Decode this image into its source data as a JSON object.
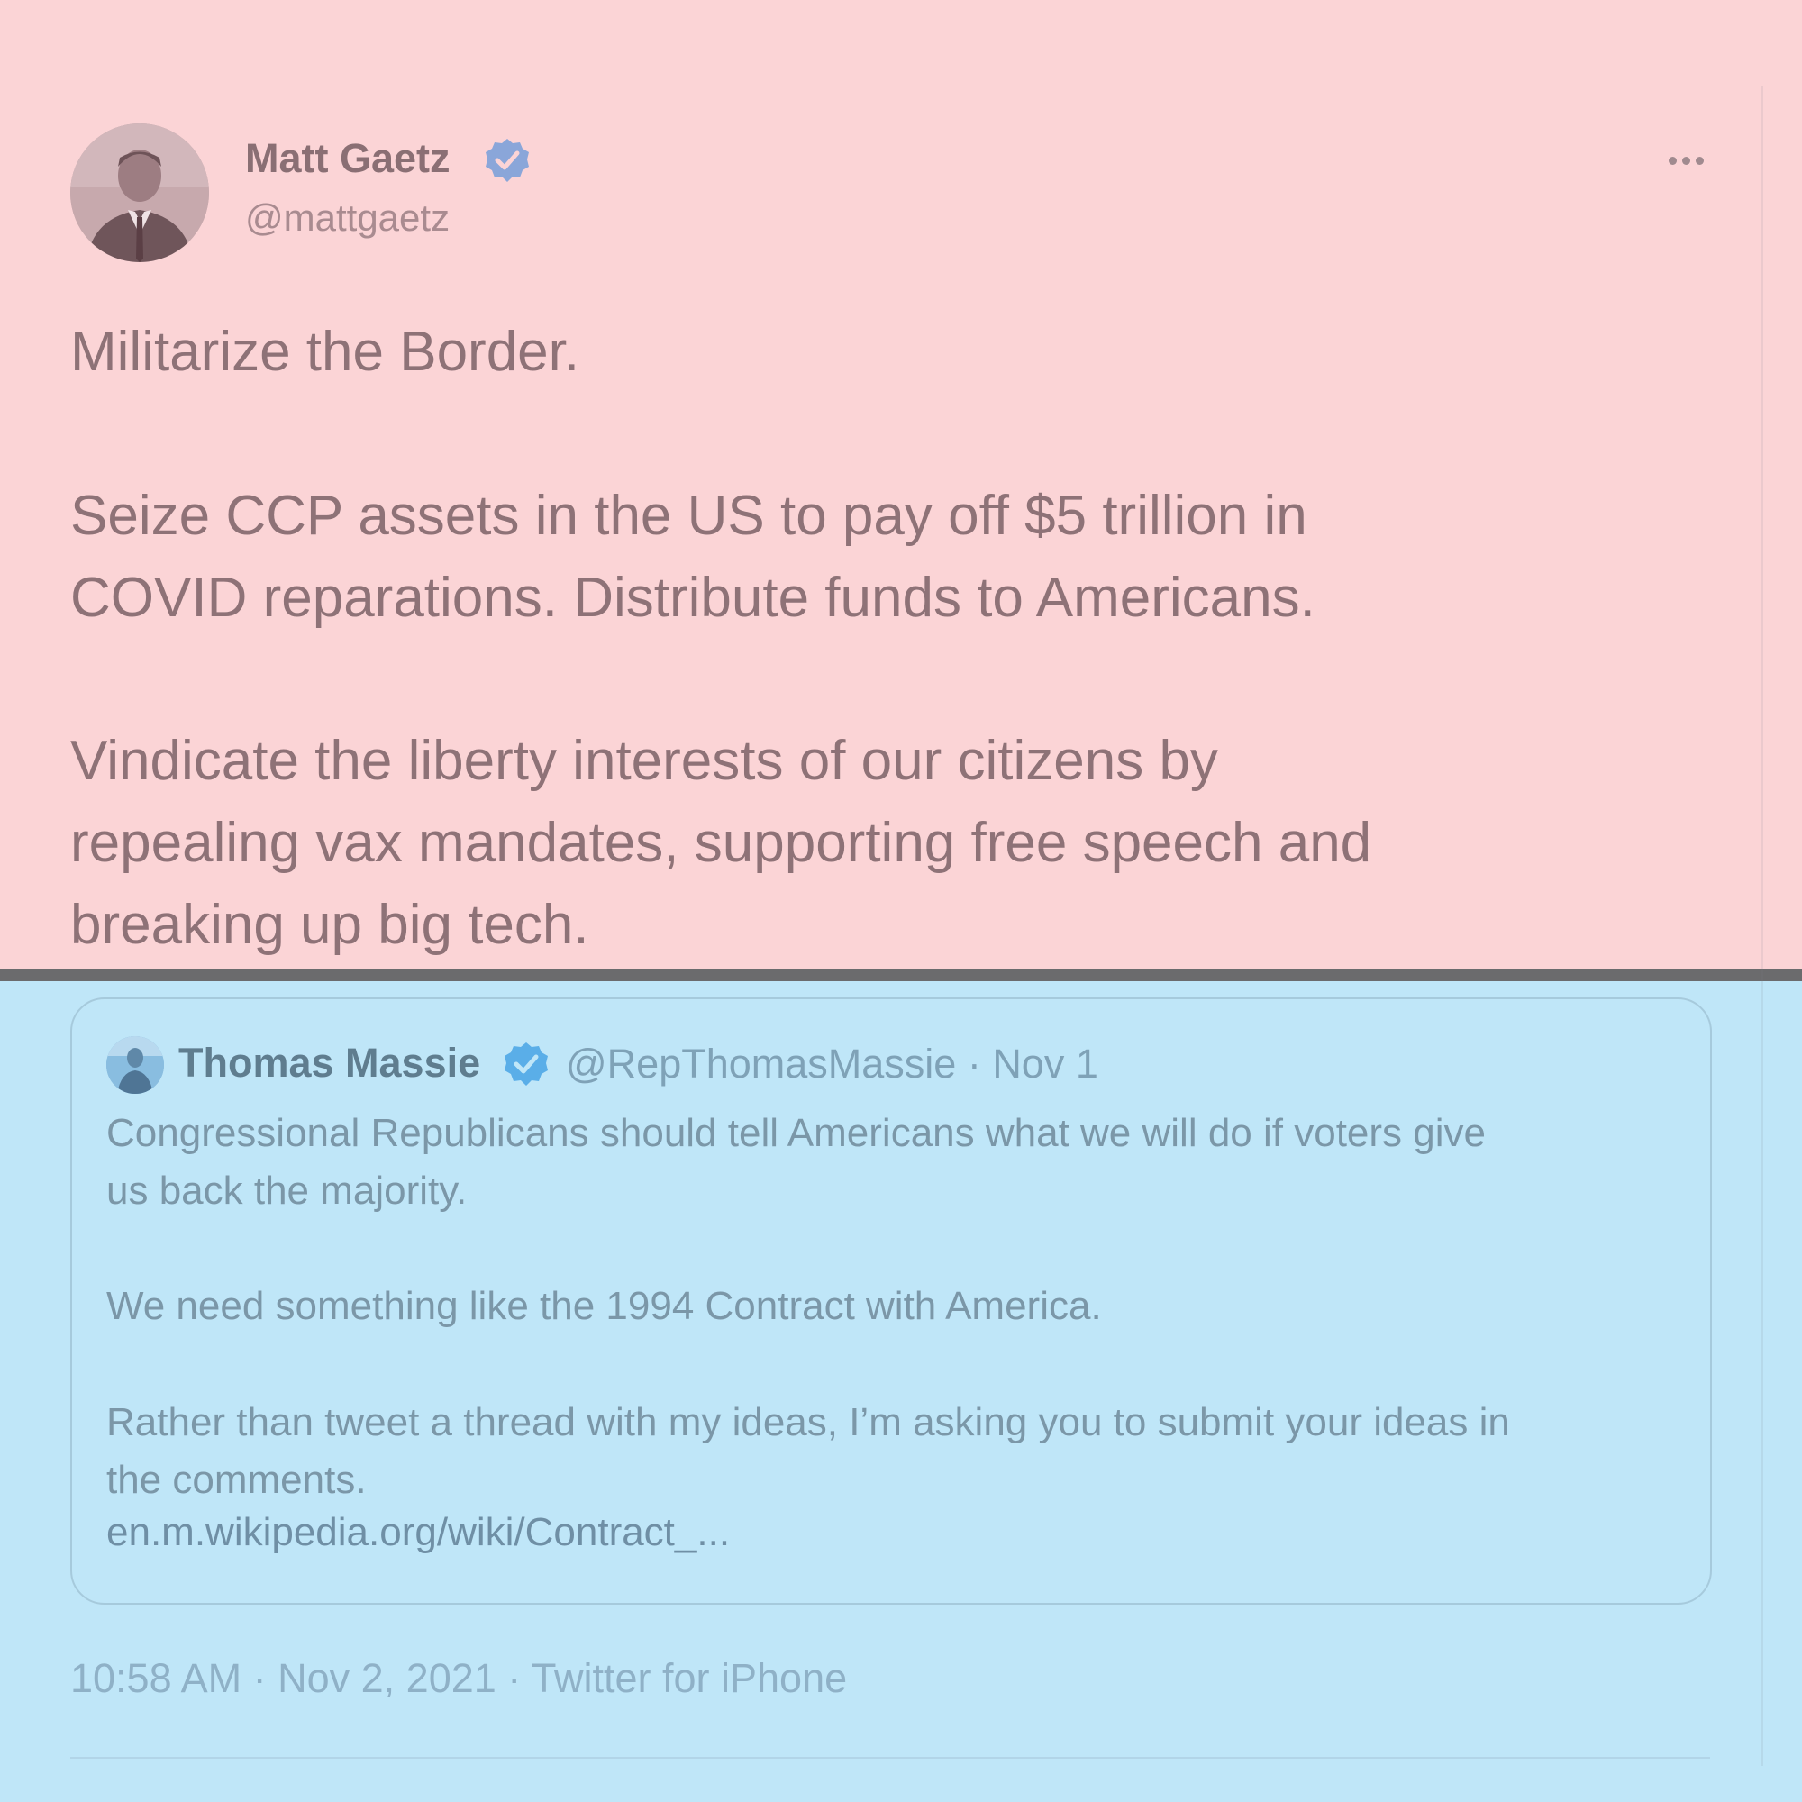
{
  "tweet": {
    "author_name": "Matt Gaetz",
    "author_handle": "@mattgaetz",
    "avatar_icon": "portrait-avatar",
    "verified_icon": "verified-badge-icon",
    "more_icon": "more-options-icon",
    "paragraphs": [
      [
        "Militarize the Border."
      ],
      [
        "Seize CCP assets in the US to pay off $5 trillion in",
        "COVID reparations.  Distribute funds to Americans."
      ],
      [
        "Vindicate the liberty interests of our citizens by",
        "repealing vax mandates, supporting free speech and",
        "breaking up big tech."
      ]
    ],
    "timestamp": "10:58 AM · Nov 2, 2021 · Twitter for iPhone"
  },
  "quoted_tweet": {
    "author_name": "Thomas Massie",
    "author_handle": "@RepThomasMassie",
    "date": "Nov 1",
    "meta_text": "@RepThomasMassie · Nov 1",
    "paragraphs": [
      [
        "Congressional Republicans should tell Americans what we will do if voters give",
        "us back the majority."
      ],
      [
        "We need something like the 1994 Contract with America."
      ],
      [
        "Rather than tweet a thread with my ideas, I’m asking you to submit your ideas in",
        "the comments."
      ]
    ],
    "link": "en.m.wikipedia.org/wiki/Contract_..."
  },
  "colors": {
    "top_overlay": "#fbd4d6",
    "bottom_overlay": "#bfe6f8",
    "divider": "#6b6b6d",
    "verified_main": "#8aa6d9",
    "verified_quote": "#5aaee8"
  }
}
